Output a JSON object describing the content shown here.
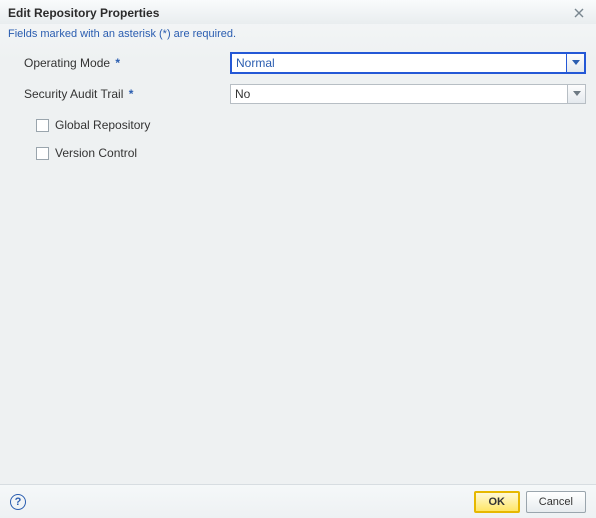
{
  "titlebar": {
    "title": "Edit Repository Properties"
  },
  "hint": "Fields marked with an asterisk (*) are required.",
  "fields": {
    "operating_mode": {
      "label": "Operating Mode",
      "required_marker": "*",
      "value": "Normal"
    },
    "security_audit_trail": {
      "label": "Security Audit Trail",
      "required_marker": "*",
      "value": "No"
    },
    "global_repository": {
      "label": "Global Repository",
      "checked": false
    },
    "version_control": {
      "label": "Version Control",
      "checked": false
    }
  },
  "footer": {
    "help_glyph": "?",
    "ok_label": "OK",
    "cancel_label": "Cancel"
  }
}
